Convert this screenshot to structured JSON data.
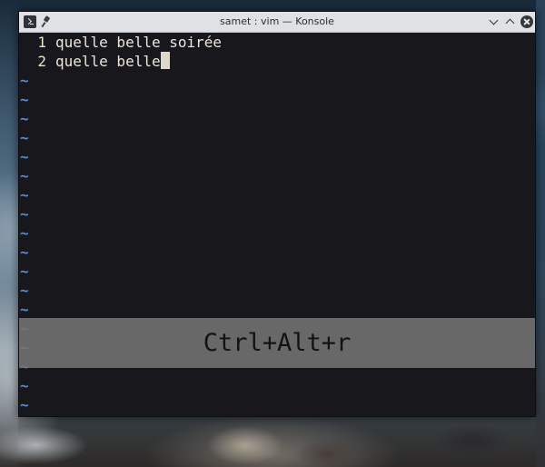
{
  "window": {
    "title": "samet : vim — Konsole"
  },
  "editor": {
    "lines": [
      {
        "number": "1",
        "text": "quelle belle soirée"
      },
      {
        "number": "2",
        "text": "quelle belle"
      }
    ],
    "empty_marker": "~"
  },
  "overlay": {
    "shortcut": "Ctrl+Alt+r"
  },
  "icons": {
    "app": "terminal-icon",
    "pin": "pin-icon",
    "minimize": "chevron-down-icon",
    "maximize": "chevron-up-icon",
    "close": "close-icon"
  },
  "colors": {
    "terminal_bg": "#18171c",
    "text": "#ebe6dc",
    "tilde": "#4f8fd6",
    "titlebar": "#dfe1e4"
  }
}
